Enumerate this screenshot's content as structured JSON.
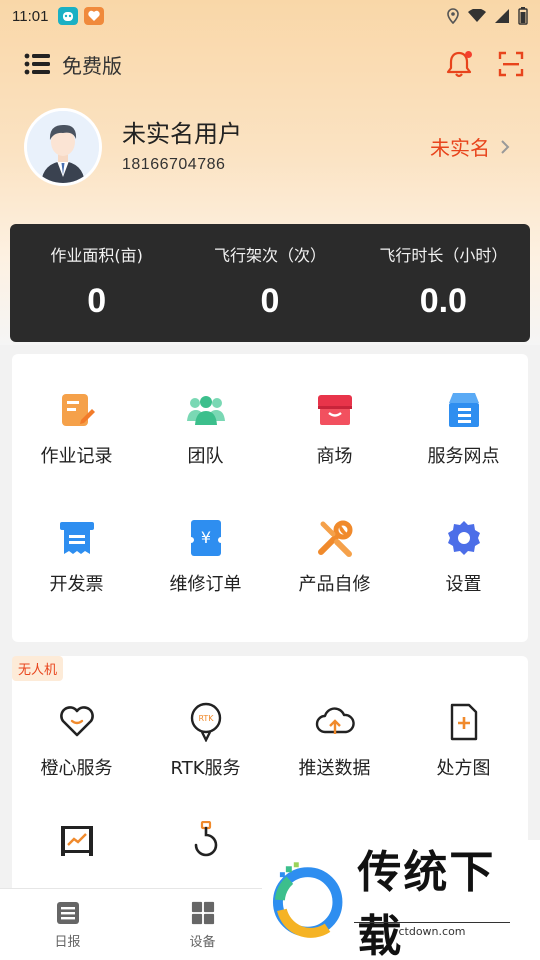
{
  "status_bar": {
    "time": "11:01"
  },
  "header": {
    "title": "免费版"
  },
  "profile": {
    "name": "未实名用户",
    "phone": "18166704786",
    "verify_label": "未实名"
  },
  "stats": [
    {
      "label": "作业面积(亩)",
      "value": "0"
    },
    {
      "label": "飞行架次（次）",
      "value": "0"
    },
    {
      "label": "飞行时长（小时）",
      "value": "0.0"
    }
  ],
  "services": [
    {
      "label": "作业记录",
      "icon": "task-record-icon",
      "color": "#f5a14a"
    },
    {
      "label": "团队",
      "icon": "team-icon",
      "color": "#3cbf8c"
    },
    {
      "label": "商场",
      "icon": "mall-icon",
      "color": "#e8344a"
    },
    {
      "label": "服务网点",
      "icon": "service-point-icon",
      "color": "#2e8ef0"
    },
    {
      "label": "开发票",
      "icon": "invoice-icon",
      "color": "#2e8ef0"
    },
    {
      "label": "维修订单",
      "icon": "repair-order-icon",
      "color": "#2e8ef0"
    },
    {
      "label": "产品自修",
      "icon": "wrench-icon",
      "color": "#f08a2c"
    },
    {
      "label": "设置",
      "icon": "gear-icon",
      "color": "#4c6ee8"
    }
  ],
  "drone_section": {
    "tag": "无人机",
    "items": [
      {
        "label": "橙心服务",
        "icon": "heart-service-icon"
      },
      {
        "label": "RTK服务",
        "icon": "rtk-icon",
        "icon_text": "RTK"
      },
      {
        "label": "推送数据",
        "icon": "cloud-upload-icon"
      },
      {
        "label": "处方图",
        "icon": "prescription-map-icon"
      },
      {
        "label": "",
        "icon": "flight-log-icon"
      },
      {
        "label": "",
        "icon": "hook-icon"
      }
    ]
  },
  "bottom_nav": [
    {
      "label": "日报",
      "icon": "daily-report-icon"
    },
    {
      "label": "设备",
      "icon": "device-icon"
    }
  ],
  "watermark": {
    "text": "传统下载",
    "url": "ctdown.com"
  },
  "colors": {
    "accent": "#e8441c",
    "stats_bg": "#2b2b2b",
    "header_gradient_top": "#f9d7a8"
  }
}
